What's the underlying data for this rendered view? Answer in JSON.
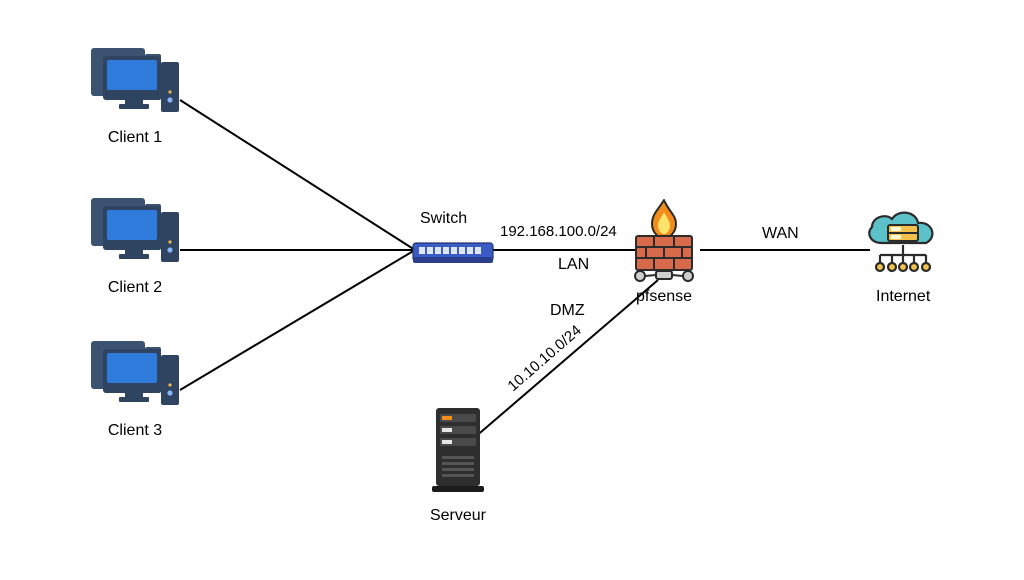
{
  "nodes": {
    "client1": {
      "label": "Client 1"
    },
    "client2": {
      "label": "Client 2"
    },
    "client3": {
      "label": "Client 3"
    },
    "switch": {
      "label": "Switch"
    },
    "firewall": {
      "label": "pfsense"
    },
    "internet": {
      "label": "Internet"
    },
    "server": {
      "label": "Serveur"
    }
  },
  "links": {
    "lan_subnet": "192.168.100.0/24",
    "lan_label": "LAN",
    "wan_label": "WAN",
    "dmz_label": "DMZ",
    "dmz_subnet": "10.10.10.0/24"
  }
}
